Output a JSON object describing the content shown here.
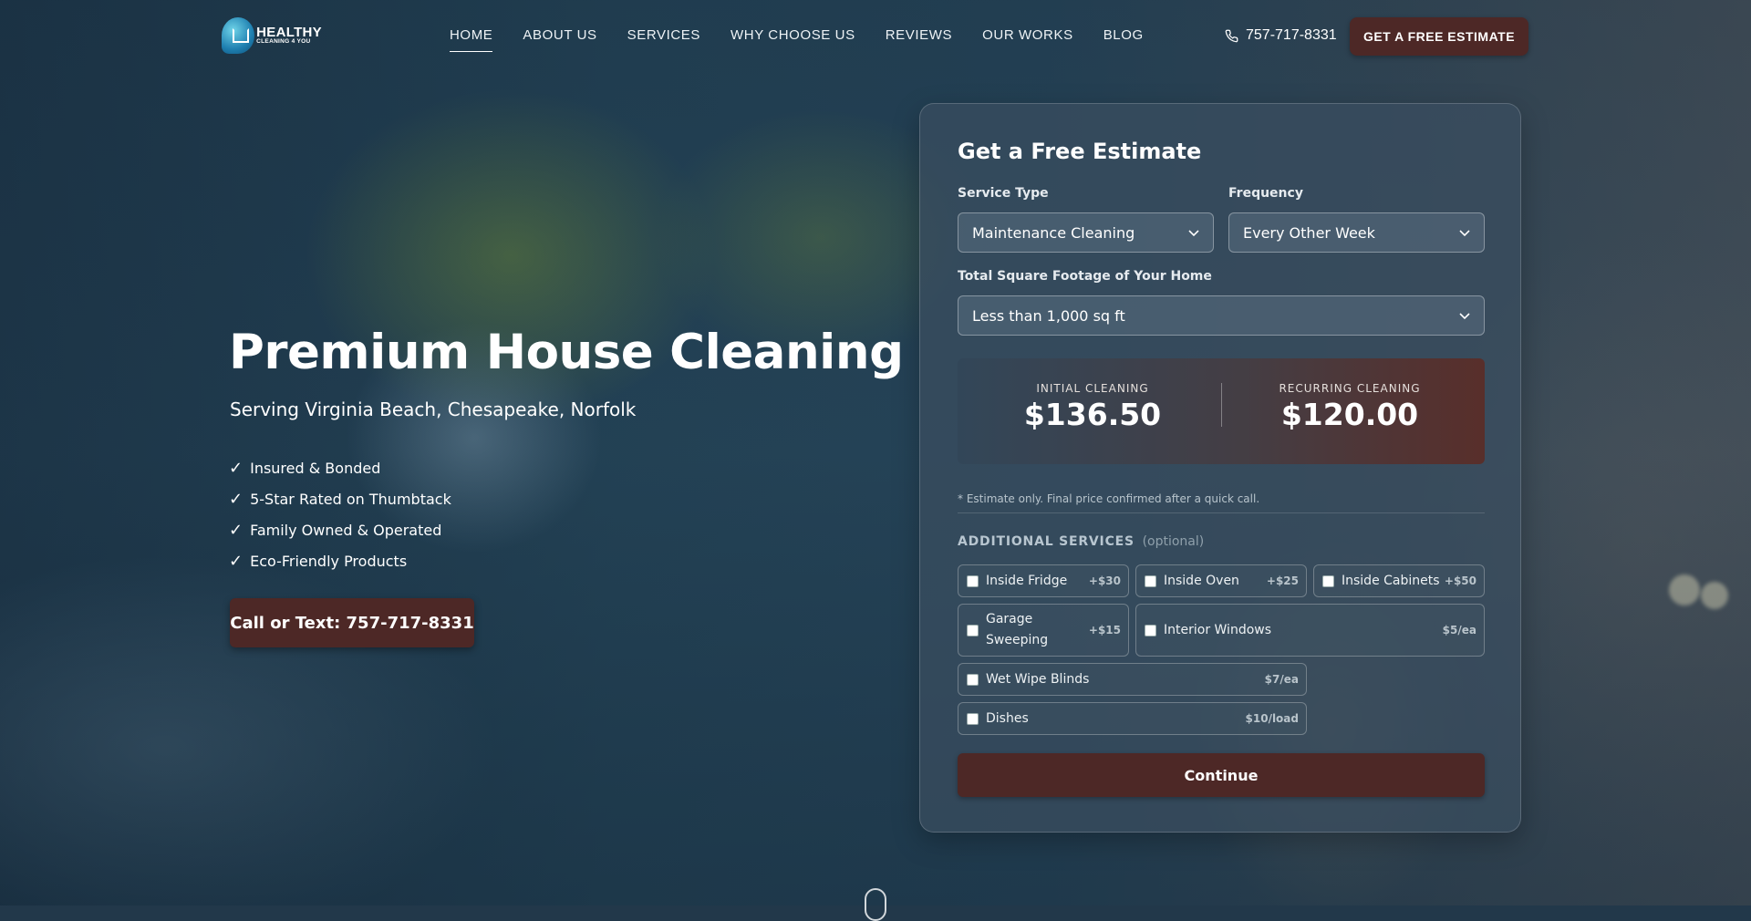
{
  "header": {
    "logo": {
      "line1": "HEALTHY",
      "line2": "CLEANING 4 YOU"
    },
    "nav": [
      {
        "label": "HOME",
        "active": true
      },
      {
        "label": "ABOUT US"
      },
      {
        "label": "SERVICES"
      },
      {
        "label": "WHY CHOOSE US"
      },
      {
        "label": "REVIEWS"
      },
      {
        "label": "OUR WORKS"
      },
      {
        "label": "BLOG"
      }
    ],
    "phone": "757-717-8331",
    "phone_icon": "phone-icon",
    "cta": "GET A FREE ESTIMATE"
  },
  "hero": {
    "title": "Premium House Cleaning",
    "subtitle": "Serving Virginia Beach, Chesapeake, Norfolk",
    "check_glyph": "✓",
    "features": [
      "Insured & Bonded",
      "5-Star Rated on Thumbtack",
      "Family Owned & Operated",
      "Eco-Friendly Products"
    ],
    "button": "Call or Text: 757-717-8331"
  },
  "estimate": {
    "title": "Get a Free Estimate",
    "service_type": {
      "label": "Service Type",
      "value": "Maintenance Cleaning"
    },
    "frequency": {
      "label": "Frequency",
      "value": "Every Other Week"
    },
    "square_footage": {
      "label": "Total Square Footage of Your Home",
      "value": "Less than 1,000 sq ft"
    },
    "initial": {
      "label": "INITIAL CLEANING",
      "price": "$136.50"
    },
    "recurring": {
      "label": "RECURRING CLEANING",
      "price": "$120.00"
    },
    "note": "* Estimate only. Final price confirmed after a quick call.",
    "additional": {
      "heading": "ADDITIONAL SERVICES",
      "optional": "(optional)"
    },
    "addons": [
      {
        "name": "Inside Fridge",
        "price": "+$30",
        "checked": false
      },
      {
        "name": "Inside Oven",
        "price": "+$25",
        "checked": false
      },
      {
        "name": "Inside Cabinets",
        "price": "+$50",
        "checked": false
      },
      {
        "name": "Garage Sweeping",
        "price": "+$15",
        "checked": false
      },
      {
        "name": "Interior Windows",
        "price": "$5/ea",
        "checked": false
      },
      {
        "name": "Wet Wipe Blinds",
        "price": "$7/ea",
        "checked": false
      },
      {
        "name": "Dishes",
        "price": "$10/load",
        "checked": false
      }
    ],
    "continue": "Continue"
  },
  "colors": {
    "accent": "#4d2826",
    "card": "#3a4e60"
  }
}
